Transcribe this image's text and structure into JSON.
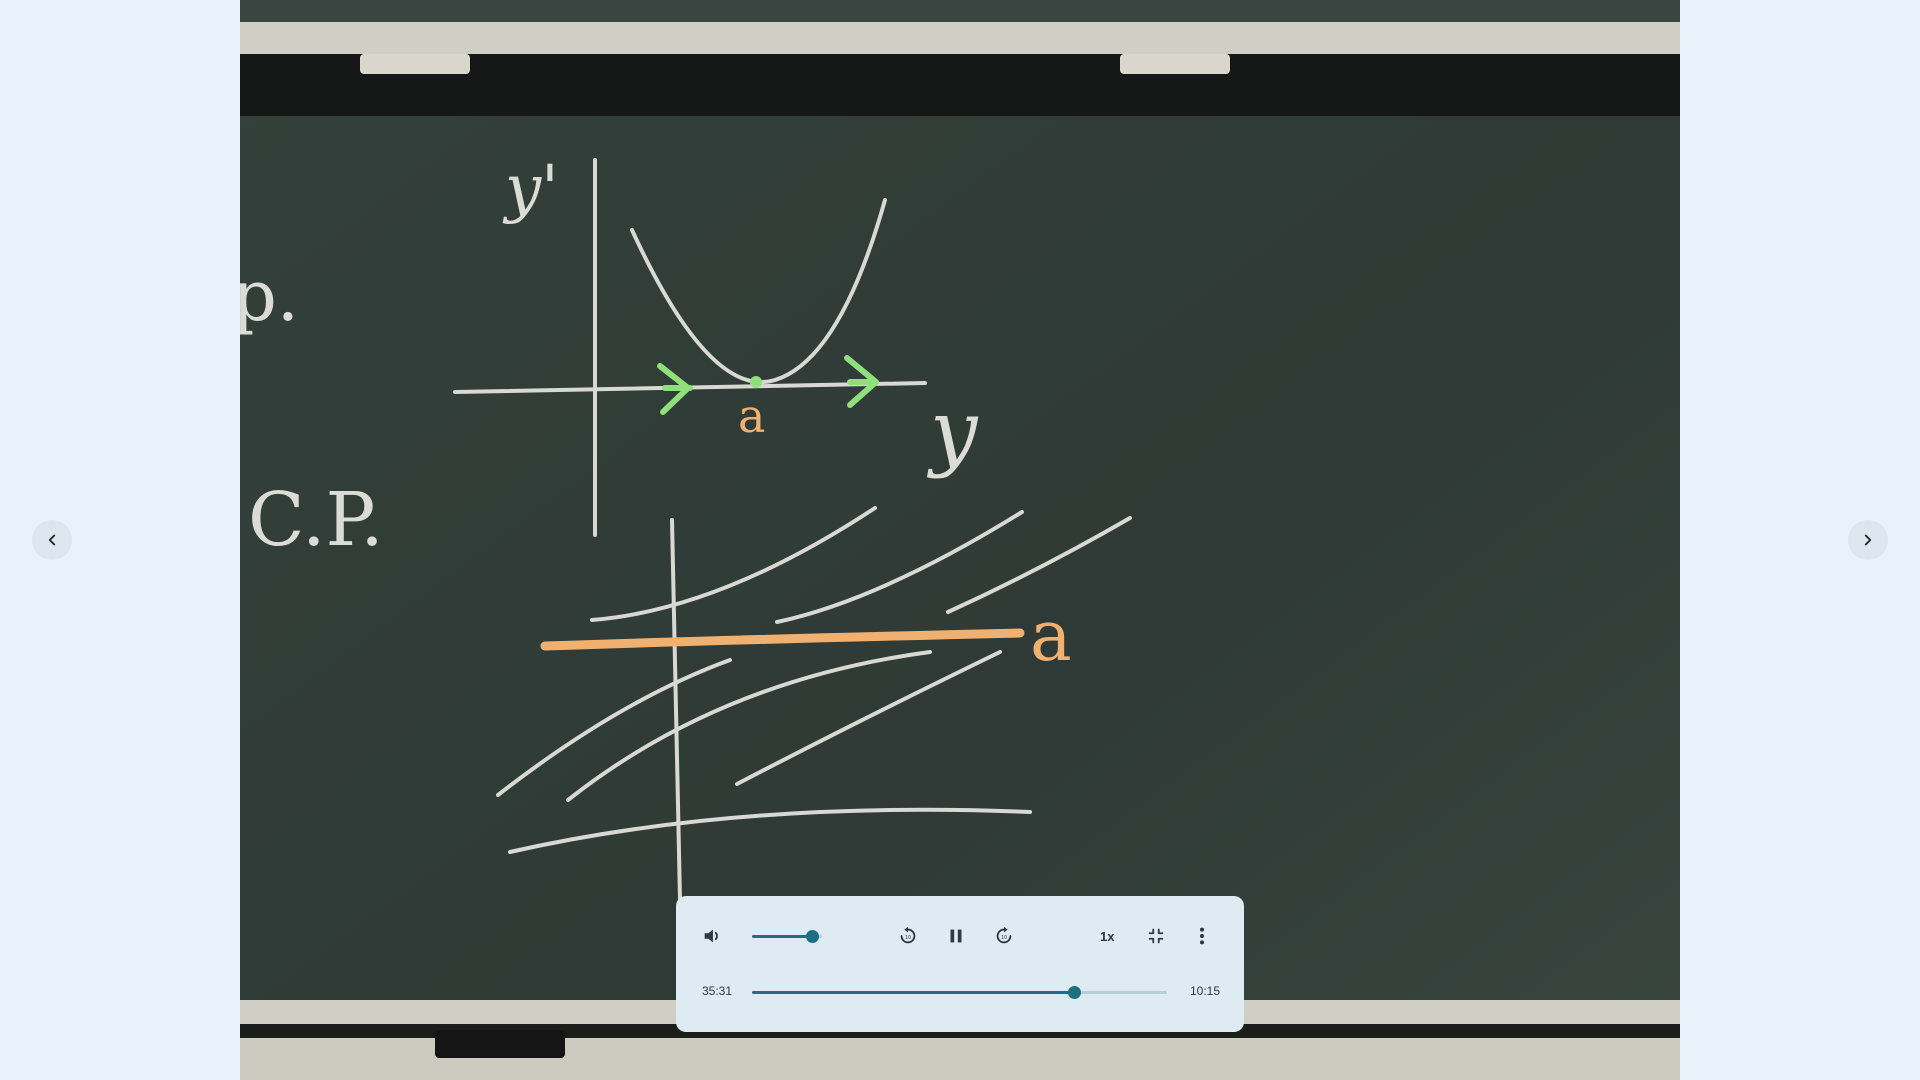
{
  "player": {
    "speed_label": "1x",
    "current_time": "35:31",
    "duration": "10:15",
    "progress_fraction": 0.775,
    "volume_fraction": 0.85
  },
  "board": {
    "label_y_prime": "y'",
    "label_y": "y",
    "label_a_top": "a",
    "label_a_bottom": "a",
    "label_p": "p.",
    "label_cp": "C.P."
  },
  "icons": {
    "prev": "chevron-left-icon",
    "next": "chevron-right-icon",
    "volume": "volume-icon",
    "rewind": "rewind-10-icon",
    "pause": "pause-icon",
    "forward": "forward-10-icon",
    "exit_fullscreen": "exit-fullscreen-icon",
    "more": "more-vert-icon"
  },
  "colors": {
    "accent": "#1e6f82",
    "chalk_white": "#d9d9d4",
    "chalk_green": "#8fe07a",
    "chalk_orange": "#f0b070",
    "board": "#2f3a36",
    "page_bg": "#e9f1fa"
  }
}
